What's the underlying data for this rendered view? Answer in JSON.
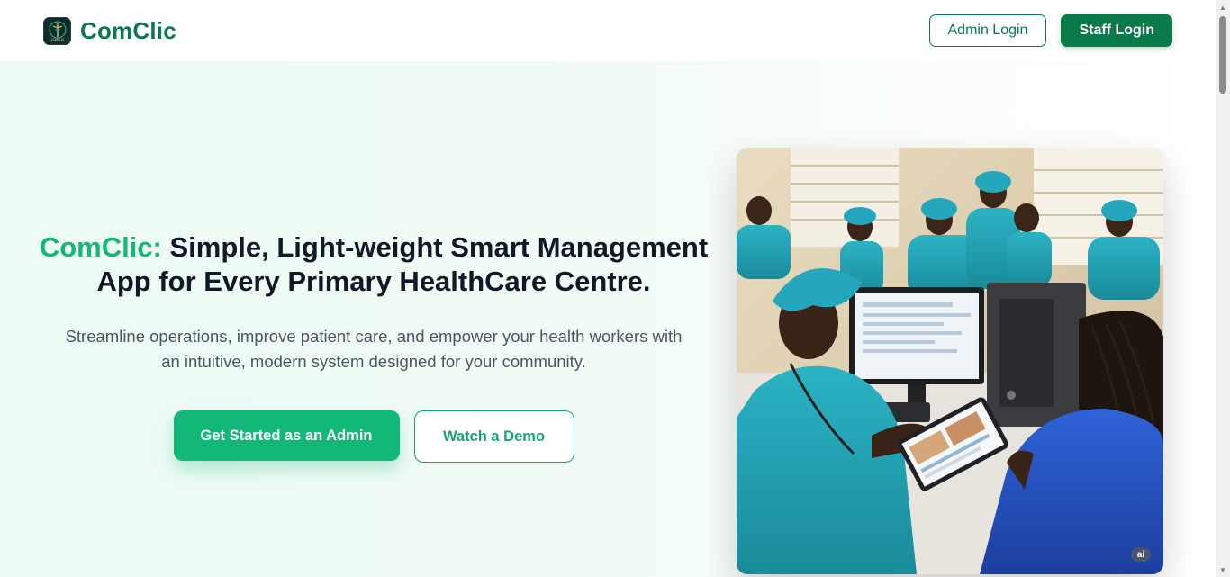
{
  "header": {
    "brand_name": "ComClic",
    "logo_text": "COMCLIC",
    "admin_login": "Admin Login",
    "staff_login": "Staff Login"
  },
  "hero": {
    "title_accent": "ComClic:",
    "title_rest": " Simple, Light-weight Smart Management App for Every Primary HealthCare Centre.",
    "subtitle": "Streamline operations, improve patient care, and empower your health workers with an intuitive, modern system designed for your community.",
    "primary_cta": "Get Started as an Admin",
    "secondary_cta": "Watch a Demo",
    "image_badge": "ai"
  },
  "colors": {
    "brand": "#0b7a4b",
    "accent": "#14b874",
    "hero_bg": "#ecfbf3"
  },
  "icons": {
    "logo": "caduceus-logo-icon",
    "scroll_up": "chevron-up-icon",
    "scroll_down": "chevron-down-icon"
  }
}
